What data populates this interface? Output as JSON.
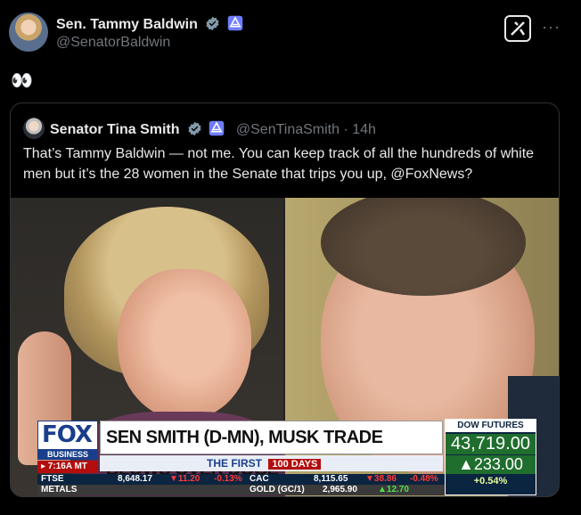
{
  "author": {
    "name": "Sen. Tammy Baldwin",
    "handle": "@SenatorBaldwin"
  },
  "tweet": {
    "text": "👀"
  },
  "quote": {
    "name": "Senator Tina Smith",
    "handle_time": "@SenTinaSmith · 14h",
    "text": "That’s Tammy Baldwin — not me. You can keep track of all the hundreds of white men but it’s the 28 women in the Senate that trips you up, @FoxNews?"
  },
  "ticker": {
    "logo": "FOX",
    "logo_sub": "BUSINESS",
    "time": "▸ 7:16A MT",
    "headline": "SEN SMITH (D-MN), MUSK TRADE BLOWS OVER DOGE",
    "sub_label": "THE FIRST",
    "sub_tag": "100 DAYS",
    "dow_title": "DOW FUTURES",
    "dow_value": "43,719.00",
    "dow_change": "▲233.00",
    "dow_pct": "+0.54%",
    "row1": {
      "a": "FTSE",
      "b": "8,648.17",
      "c": "▼11.20",
      "d": "-0.13%",
      "e": "CAC",
      "f": "8,115.65",
      "g": "▼38.86",
      "h": "-0.48%"
    },
    "row2": {
      "a": "METALS",
      "b": "GOLD (GC/1)",
      "c": "2,965.90",
      "d": "▲12.70"
    }
  },
  "colors": {
    "accent": "#1d9bf0",
    "fox_blue": "#1a3e8c",
    "fox_red": "#b40d0d"
  },
  "icons": [
    "verified-badge-icon",
    "government-badge-icon",
    "grok-icon",
    "more-icon"
  ]
}
